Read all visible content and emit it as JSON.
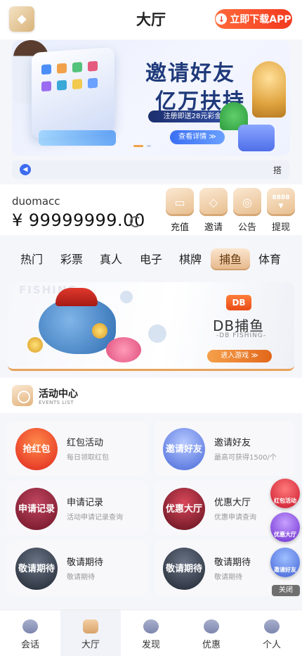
{
  "header": {
    "title": "大厅",
    "download_label": "立即下载APP"
  },
  "banner": {
    "headline_1": "邀请好友",
    "headline_2": "亿万扶持",
    "tag": "注册即送28元彩金",
    "button": "查看详情 ≫"
  },
  "notice": {
    "text": "搭"
  },
  "wallet": {
    "username": "duomacc",
    "balance": "¥ 99999999.00",
    "actions": [
      {
        "label": "充值",
        "icon": "wallet-icon"
      },
      {
        "label": "邀请",
        "icon": "diamond-icon"
      },
      {
        "label": "公告",
        "icon": "megaphone-icon"
      },
      {
        "label": "提现",
        "icon": "withdraw-icon",
        "badge": "8888"
      }
    ]
  },
  "tabs": [
    "热门",
    "彩票",
    "真人",
    "电子",
    "棋牌",
    "捕鱼",
    "体育"
  ],
  "active_tab": "捕鱼",
  "game": {
    "bg_text": "FISHING",
    "logo": "DB",
    "title": "DB捕鱼",
    "subtitle": "-DB FISHING-",
    "button": "进入游戏 ≫"
  },
  "events": {
    "title": "活动中心",
    "subtitle": "EVENTS LIST",
    "items": [
      {
        "title": "红包活动",
        "desc": "每日领取红包",
        "img_text": "抢红包"
      },
      {
        "title": "邀请好友",
        "desc": "最高可获得1500/个",
        "img_text": "邀请好友"
      },
      {
        "title": "申请记录",
        "desc": "活动申请记录查询",
        "img_text": "申请记录"
      },
      {
        "title": "优惠大厅",
        "desc": "优惠申请查询",
        "img_text": "优惠大厅"
      },
      {
        "title": "敬请期待",
        "desc": "敬请期待",
        "img_text": "敬请期待"
      },
      {
        "title": "敬请期待",
        "desc": "敬请期待",
        "img_text": "敬请期待"
      }
    ]
  },
  "floating": [
    {
      "label": "红包活动"
    },
    {
      "label": "优惠大厅"
    },
    {
      "label": "邀请好友"
    }
  ],
  "close_label": "关闭",
  "nav": [
    "会话",
    "大厅",
    "发现",
    "优惠",
    "个人"
  ],
  "active_nav": "大厅",
  "colors": {
    "accent": "#f2391f",
    "gold": "#e5b78a",
    "brand_blue": "#1f3a7a"
  }
}
